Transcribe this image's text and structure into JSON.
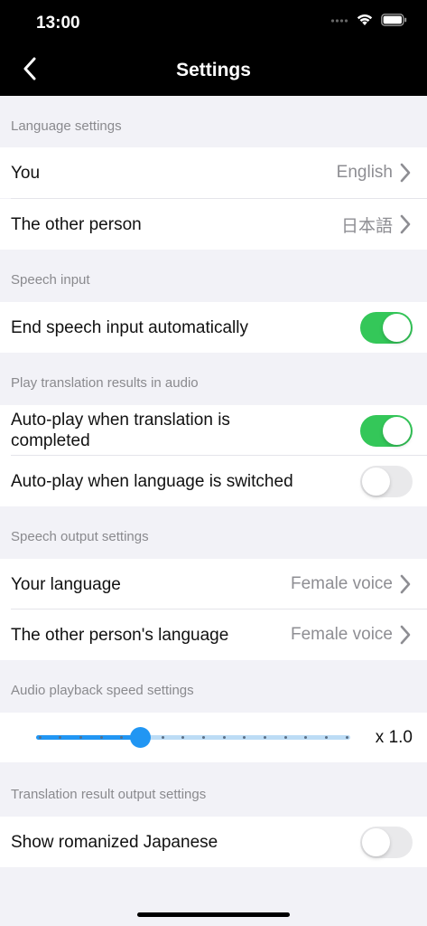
{
  "status_bar": {
    "time": "13:00"
  },
  "nav": {
    "title": "Settings"
  },
  "sections": {
    "language": {
      "header": "Language settings",
      "you_label": "You",
      "you_value": "English",
      "other_label": "The other person",
      "other_value": "日本語"
    },
    "speech_input": {
      "header": "Speech input",
      "end_auto_label": "End speech input automatically",
      "end_auto_on": true
    },
    "play_audio": {
      "header": "Play translation results in audio",
      "autoplay_completed_label": "Auto-play when translation is completed",
      "autoplay_completed_on": true,
      "autoplay_switched_label": "Auto-play when language is switched",
      "autoplay_switched_on": false
    },
    "speech_output": {
      "header": "Speech output settings",
      "your_lang_label": "Your language",
      "your_lang_value": "Female voice",
      "other_lang_label": "The other person's language",
      "other_lang_value": "Female voice"
    },
    "playback_speed": {
      "header": "Audio playback speed settings",
      "speed_label": "x 1.0",
      "slider_fraction": 0.333,
      "tick_count": 16
    },
    "translation_output": {
      "header": "Translation result output settings",
      "romanized_label": "Show romanized Japanese",
      "romanized_on": false
    }
  },
  "colors": {
    "toggle_on": "#34c759",
    "toggle_off": "#e9e9eb",
    "slider_active": "#2196f3",
    "slider_inactive": "#bcdcf5"
  },
  "icons": {
    "back": "chevron-left-icon",
    "row_arrow": "chevron-right-icon",
    "wifi": "wifi-icon",
    "battery": "battery-icon",
    "signal": "signal-icon"
  }
}
